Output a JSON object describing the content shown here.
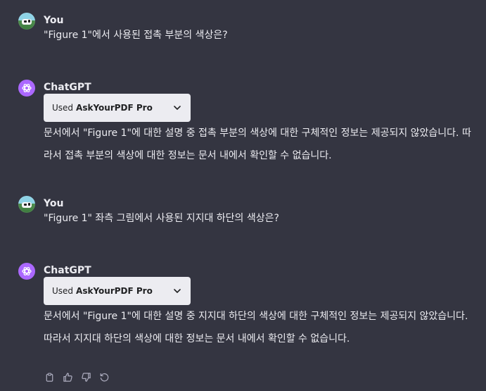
{
  "messages": [
    {
      "role": "user",
      "author": "You",
      "text": "\"Figure 1\"에서 사용된 접촉 부분의 색상은?"
    },
    {
      "role": "assistant",
      "author": "ChatGPT",
      "plugin": {
        "used_label": "Used",
        "name": "AskYourPDF Pro"
      },
      "text": "문서에서 \"Figure 1\"에 대한 설명 중 접촉 부분의 색상에 대한 구체적인 정보는 제공되지 않았습니다. 따라서 접촉 부분의 색상에 대한 정보는 문서 내에서 확인할 수 없습니다."
    },
    {
      "role": "user",
      "author": "You",
      "text": "\"Figure 1\" 좌측 그림에서 사용된 지지대 하단의 색상은?"
    },
    {
      "role": "assistant",
      "author": "ChatGPT",
      "plugin": {
        "used_label": "Used",
        "name": "AskYourPDF Pro"
      },
      "text": "문서에서 \"Figure 1\"에 대한 설명 중 지지대 하단의 색상에 대한 구체적인 정보는 제공되지 않았습니다. 따라서 지지대 하단의 색상에 대한 정보는 문서 내에서 확인할 수 없습니다."
    }
  ],
  "actions": {
    "icons": [
      "copy-icon",
      "thumbs-up-icon",
      "thumbs-down-icon",
      "regenerate-icon"
    ]
  },
  "colors": {
    "background": "#343541",
    "text": "#ececf1",
    "gpt_avatar": "#ab68ff",
    "pill_bg": "#ececf1",
    "pill_text": "#202123",
    "icon": "#acacbe"
  }
}
